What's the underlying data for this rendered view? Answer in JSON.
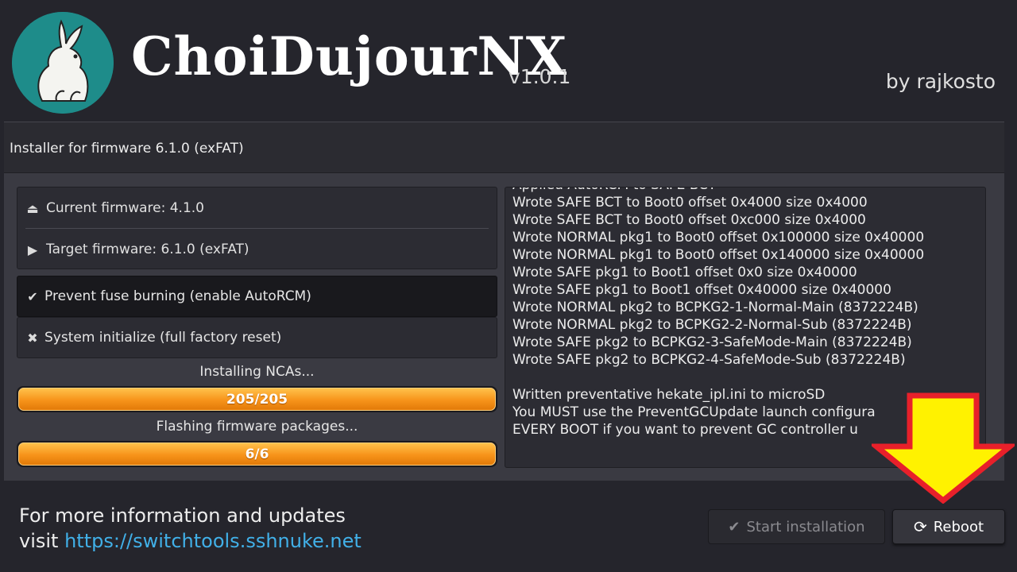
{
  "header": {
    "title": "ChoiDujourNX",
    "version": "v1.0.1",
    "author": "by rajkosto",
    "logo_icon": "rabbit-logo"
  },
  "panel": {
    "subtitle": "Installer for firmware 6.1.0 (exFAT)",
    "current_firmware": "Current firmware: 4.1.0",
    "target_firmware": "Target firmware: 6.1.0 (exFAT)",
    "options": [
      {
        "label": "Prevent fuse burning (enable AutoRCM)",
        "checked": true,
        "icon": "checkmark-icon"
      },
      {
        "label": "System initialize (full factory reset)",
        "checked": false,
        "icon": "x-icon"
      }
    ],
    "progress": [
      {
        "label": "Installing NCAs...",
        "text": "205/205",
        "fraction": 1.0
      },
      {
        "label": "Flashing firmware packages...",
        "text": "6/6",
        "fraction": 1.0
      }
    ]
  },
  "log": {
    "lines": [
      "Applied AutoRCM to SAFE BCT",
      "Wrote SAFE BCT to Boot0 offset 0x4000 size 0x4000",
      "Wrote SAFE BCT to Boot0 offset 0xc000 size 0x4000",
      "Wrote NORMAL pkg1 to Boot0 offset 0x100000 size 0x40000",
      "Wrote NORMAL pkg1 to Boot0 offset 0x140000 size 0x40000",
      "Wrote SAFE pkg1 to Boot1 offset 0x0 size 0x40000",
      "Wrote SAFE pkg1 to Boot1 offset 0x40000 size 0x40000",
      "Wrote NORMAL pkg2 to BCPKG2-1-Normal-Main (8372224B)",
      "Wrote NORMAL pkg2 to BCPKG2-2-Normal-Sub (8372224B)",
      "Wrote SAFE pkg2 to BCPKG2-3-SafeMode-Main (8372224B)",
      "Wrote SAFE pkg2 to BCPKG2-4-SafeMode-Sub (8372224B)",
      "",
      "Written preventative hekate_ipl.ini to microSD",
      "You MUST use the PreventGCUpdate launch configura",
      "EVERY BOOT if you want to prevent GC controller u"
    ]
  },
  "footer": {
    "info_line1": "For more information and updates",
    "info_prefix": "visit ",
    "link": "https://switchtools.sshnuke.net",
    "start_button": "Start installation",
    "reboot_button": "Reboot"
  },
  "colors": {
    "accent_orange": "#f7931a",
    "link_blue": "#41b0e8",
    "annotation_yellow": "#fff200",
    "annotation_red": "#e8202a"
  }
}
